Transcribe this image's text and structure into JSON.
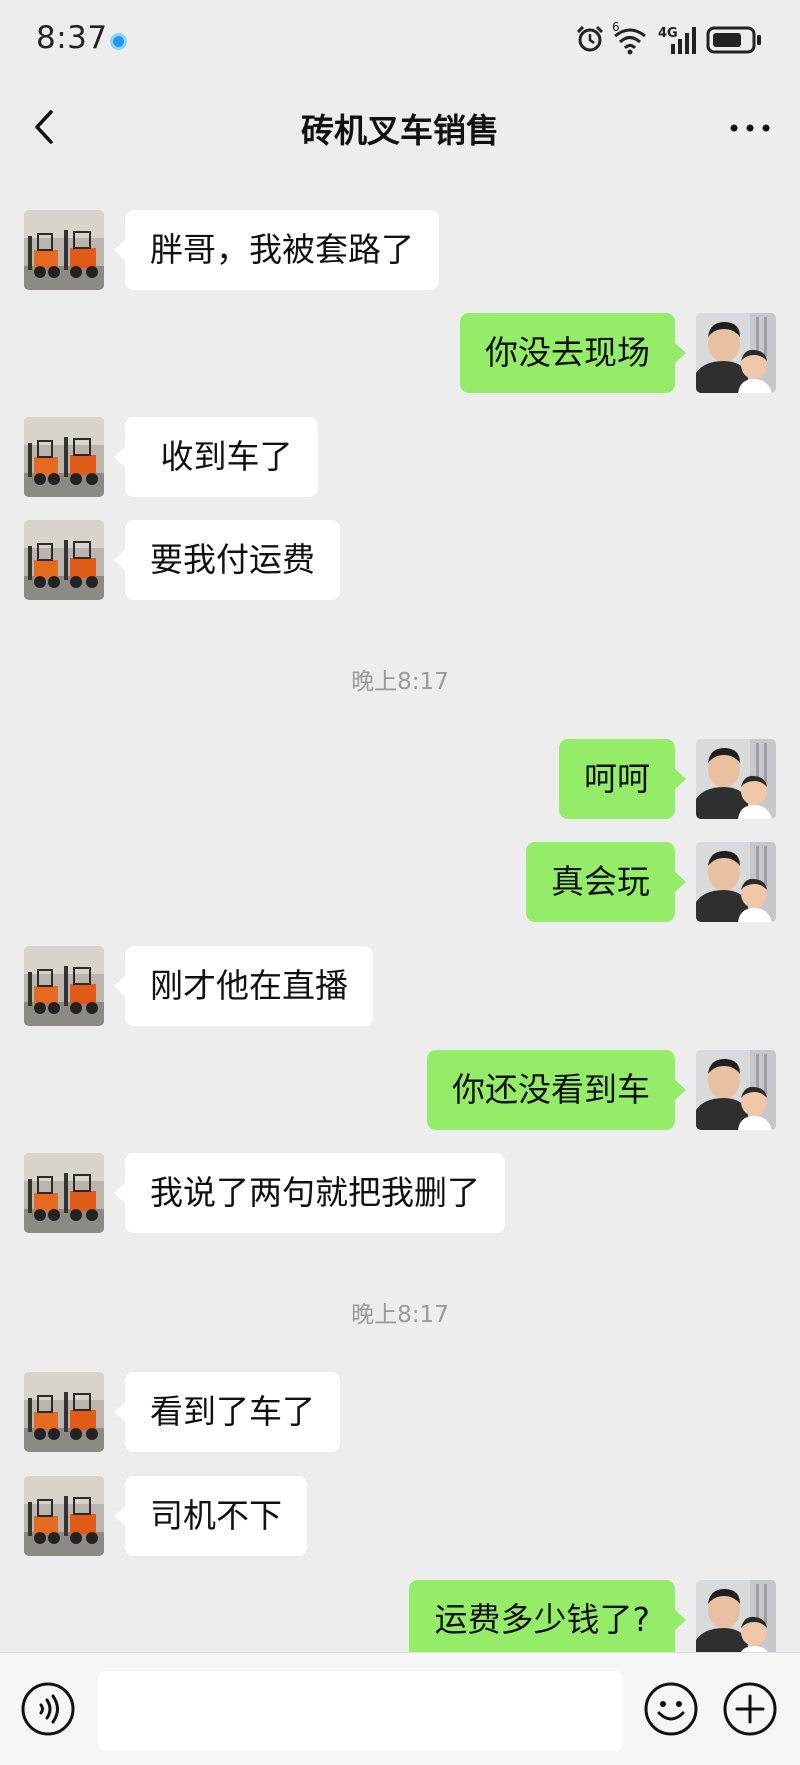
{
  "status_bar": {
    "time": "8:37",
    "network": "4G",
    "sim": "6"
  },
  "header": {
    "title": "砖机叉车销售"
  },
  "messages": [
    {
      "side": "left",
      "text": "胖哥，我被套路了"
    },
    {
      "side": "right",
      "text": "你没去现场"
    },
    {
      "side": "left",
      "text": " 收到车了"
    },
    {
      "side": "left",
      "text": "要我付运费"
    },
    {
      "type": "time",
      "text": "晚上8:17"
    },
    {
      "side": "right",
      "text": "呵呵"
    },
    {
      "side": "right",
      "text": "真会玩"
    },
    {
      "side": "left",
      "text": "刚才他在直播"
    },
    {
      "side": "right",
      "text": "你还没看到车"
    },
    {
      "side": "left",
      "text": "我说了两句就把我删了"
    },
    {
      "type": "time",
      "text": "晚上8:17"
    },
    {
      "side": "left",
      "text": "看到了车了"
    },
    {
      "side": "left",
      "text": "司机不下"
    },
    {
      "side": "right",
      "text": "运费多少钱了?"
    }
  ],
  "input": {
    "value": "",
    "placeholder": ""
  },
  "icons": {
    "back": "chevron-left-icon",
    "more": "more-dots-icon",
    "voice": "voice-icon",
    "emoji": "emoji-icon",
    "plus": "plus-icon"
  },
  "colors": {
    "background": "#ededed",
    "outgoing_bubble": "#95ec69",
    "incoming_bubble": "#ffffff",
    "timestamp": "#9a9a9a"
  }
}
